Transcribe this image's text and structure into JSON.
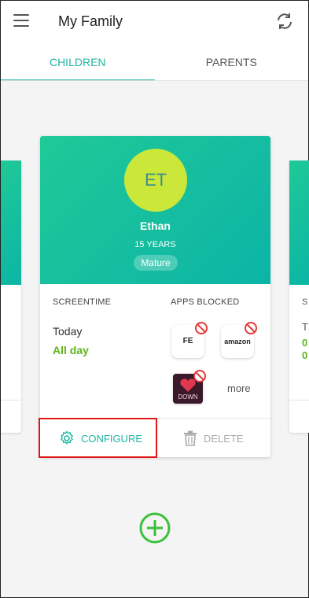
{
  "header": {
    "title": "My Family",
    "menu_icon": "hamburger-menu-icon",
    "refresh_icon": "refresh-icon"
  },
  "tabs": [
    {
      "label": "CHILDREN",
      "active": true
    },
    {
      "label": "PARENTS",
      "active": false
    }
  ],
  "card": {
    "initials": "ET",
    "name": "Ethan",
    "age": "15 YEARS",
    "rating": "Mature",
    "screentime_label": "SCREENTIME",
    "apps_blocked_label": "APPS BLOCKED",
    "screentime_day": "Today",
    "screentime_value": "All day",
    "apps": [
      {
        "label": "FE"
      },
      {
        "label": "amazon"
      },
      {
        "label": "DOWN"
      }
    ],
    "more_label": "more",
    "configure_label": "CONFIGURE",
    "delete_label": "DELETE"
  },
  "side_card_right": {
    "col_label": "S",
    "row1": "T",
    "row2": "0",
    "row3": "0"
  },
  "colors": {
    "accent": "#1fb6a0",
    "green": "#5db51a",
    "avatar": "#cbe83a",
    "highlight": "#e01515"
  }
}
